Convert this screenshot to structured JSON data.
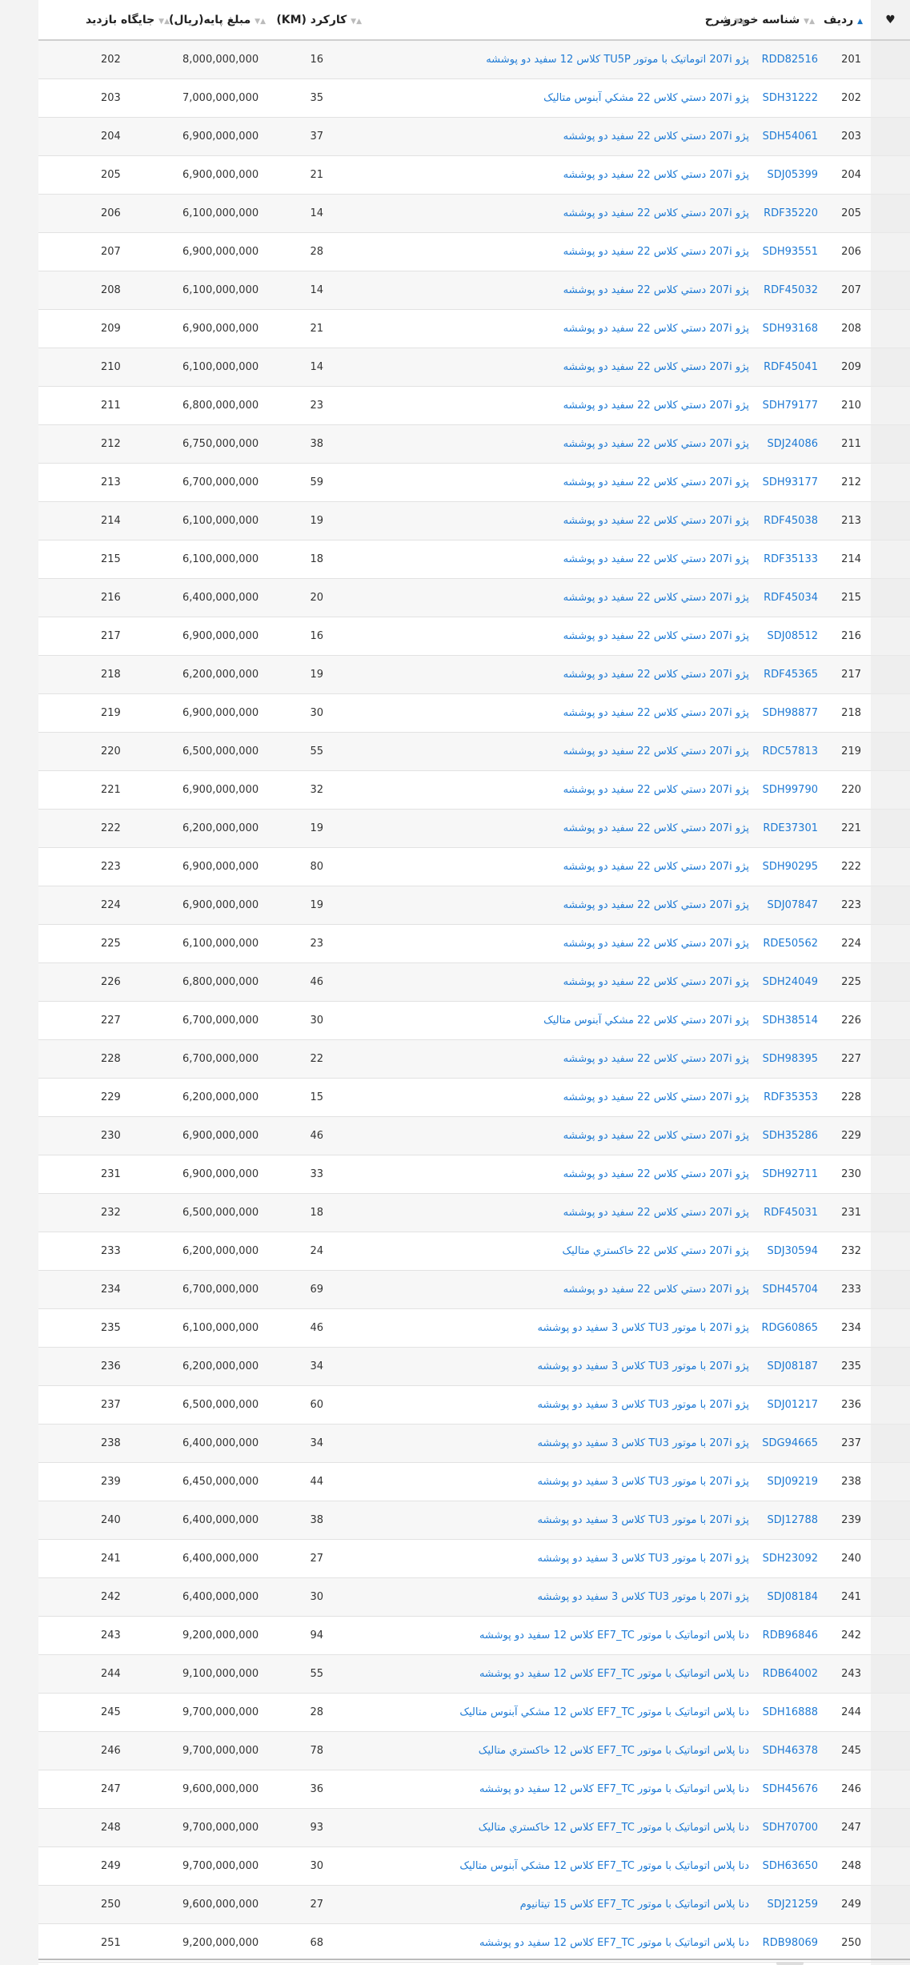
{
  "table": {
    "headers": {
      "favorite_icon": "heart-icon",
      "row": "ردیف",
      "id": "شناسه خودرو",
      "desc": "شرح",
      "km": "کارکرد (KM)",
      "price": "مبلغ پایه(ریال)",
      "visit": "جایگاه بازدید"
    },
    "rows": [
      {
        "row": "201",
        "id": "RDD82516",
        "desc": "پژو 207i اتوماتیک با موتور TU5P کلاس 12 سفید دو پوششه",
        "km": "16",
        "price": "8,000,000,000",
        "visit": "202"
      },
      {
        "row": "202",
        "id": "SDH31222",
        "desc": "پژو 207i دستي کلاس 22 مشکي آبنوس متاليک",
        "km": "35",
        "price": "7,000,000,000",
        "visit": "203"
      },
      {
        "row": "203",
        "id": "SDH54061",
        "desc": "پژو 207i دستي کلاس 22 سفيد دو پوششه",
        "km": "37",
        "price": "6,900,000,000",
        "visit": "204"
      },
      {
        "row": "204",
        "id": "SDJ05399",
        "desc": "پژو 207i دستي کلاس 22 سفيد دو پوششه",
        "km": "21",
        "price": "6,900,000,000",
        "visit": "205"
      },
      {
        "row": "205",
        "id": "RDF35220",
        "desc": "پژو 207i دستي کلاس 22 سفيد دو پوششه",
        "km": "14",
        "price": "6,100,000,000",
        "visit": "206"
      },
      {
        "row": "206",
        "id": "SDH93551",
        "desc": "پژو 207i دستي کلاس 22 سفيد دو پوششه",
        "km": "28",
        "price": "6,900,000,000",
        "visit": "207"
      },
      {
        "row": "207",
        "id": "RDF45032",
        "desc": "پژو 207i دستي کلاس 22 سفيد دو پوششه",
        "km": "14",
        "price": "6,100,000,000",
        "visit": "208"
      },
      {
        "row": "208",
        "id": "SDH93168",
        "desc": "پژو 207i دستي کلاس 22 سفيد دو پوششه",
        "km": "21",
        "price": "6,900,000,000",
        "visit": "209"
      },
      {
        "row": "209",
        "id": "RDF45041",
        "desc": "پژو 207i دستي کلاس 22 سفيد دو پوششه",
        "km": "14",
        "price": "6,100,000,000",
        "visit": "210"
      },
      {
        "row": "210",
        "id": "SDH79177",
        "desc": "پژو 207i دستي کلاس 22 سفيد دو پوششه",
        "km": "23",
        "price": "6,800,000,000",
        "visit": "211"
      },
      {
        "row": "211",
        "id": "SDJ24086",
        "desc": "پژو 207i دستي کلاس 22 سفيد دو پوششه",
        "km": "38",
        "price": "6,750,000,000",
        "visit": "212"
      },
      {
        "row": "212",
        "id": "SDH93177",
        "desc": "پژو 207i دستي کلاس 22 سفيد دو پوششه",
        "km": "59",
        "price": "6,700,000,000",
        "visit": "213"
      },
      {
        "row": "213",
        "id": "RDF45038",
        "desc": "پژو 207i دستي کلاس 22 سفيد دو پوششه",
        "km": "19",
        "price": "6,100,000,000",
        "visit": "214"
      },
      {
        "row": "214",
        "id": "RDF35133",
        "desc": "پژو 207i دستي کلاس 22 سفيد دو پوششه",
        "km": "18",
        "price": "6,100,000,000",
        "visit": "215"
      },
      {
        "row": "215",
        "id": "RDF45034",
        "desc": "پژو 207i دستي کلاس 22 سفيد دو پوششه",
        "km": "20",
        "price": "6,400,000,000",
        "visit": "216"
      },
      {
        "row": "216",
        "id": "SDJ08512",
        "desc": "پژو 207i دستي کلاس 22 سفيد دو پوششه",
        "km": "16",
        "price": "6,900,000,000",
        "visit": "217"
      },
      {
        "row": "217",
        "id": "RDF45365",
        "desc": "پژو 207i دستي کلاس 22 سفيد دو پوششه",
        "km": "19",
        "price": "6,200,000,000",
        "visit": "218"
      },
      {
        "row": "218",
        "id": "SDH98877",
        "desc": "پژو 207i دستي کلاس 22 سفيد دو پوششه",
        "km": "30",
        "price": "6,900,000,000",
        "visit": "219"
      },
      {
        "row": "219",
        "id": "RDC57813",
        "desc": "پژو 207i دستي کلاس 22 سفيد دو پوششه",
        "km": "55",
        "price": "6,500,000,000",
        "visit": "220"
      },
      {
        "row": "220",
        "id": "SDH99790",
        "desc": "پژو 207i دستي کلاس 22 سفيد دو پوششه",
        "km": "32",
        "price": "6,900,000,000",
        "visit": "221"
      },
      {
        "row": "221",
        "id": "RDE37301",
        "desc": "پژو 207i دستي کلاس 22 سفيد دو پوششه",
        "km": "19",
        "price": "6,200,000,000",
        "visit": "222"
      },
      {
        "row": "222",
        "id": "SDH90295",
        "desc": "پژو 207i دستي کلاس 22 سفيد دو پوششه",
        "km": "80",
        "price": "6,900,000,000",
        "visit": "223"
      },
      {
        "row": "223",
        "id": "SDJ07847",
        "desc": "پژو 207i دستي کلاس 22 سفيد دو پوششه",
        "km": "19",
        "price": "6,900,000,000",
        "visit": "224"
      },
      {
        "row": "224",
        "id": "RDE50562",
        "desc": "پژو 207i دستي کلاس 22 سفيد دو پوششه",
        "km": "23",
        "price": "6,100,000,000",
        "visit": "225"
      },
      {
        "row": "225",
        "id": "SDH24049",
        "desc": "پژو 207i دستي کلاس 22 سفيد دو پوششه",
        "km": "46",
        "price": "6,800,000,000",
        "visit": "226"
      },
      {
        "row": "226",
        "id": "SDH38514",
        "desc": "پژو 207i دستي کلاس 22 مشکي آبنوس متاليک",
        "km": "30",
        "price": "6,700,000,000",
        "visit": "227"
      },
      {
        "row": "227",
        "id": "SDH98395",
        "desc": "پژو 207i دستي کلاس 22 سفيد دو پوششه",
        "km": "22",
        "price": "6,700,000,000",
        "visit": "228"
      },
      {
        "row": "228",
        "id": "RDF35353",
        "desc": "پژو 207i دستي کلاس 22 سفيد دو پوششه",
        "km": "15",
        "price": "6,200,000,000",
        "visit": "229"
      },
      {
        "row": "229",
        "id": "SDH35286",
        "desc": "پژو 207i دستي کلاس 22 سفيد دو پوششه",
        "km": "46",
        "price": "6,900,000,000",
        "visit": "230"
      },
      {
        "row": "230",
        "id": "SDH92711",
        "desc": "پژو 207i دستي کلاس 22 سفيد دو پوششه",
        "km": "33",
        "price": "6,900,000,000",
        "visit": "231"
      },
      {
        "row": "231",
        "id": "RDF45031",
        "desc": "پژو 207i دستي کلاس 22 سفيد دو پوششه",
        "km": "18",
        "price": "6,500,000,000",
        "visit": "232"
      },
      {
        "row": "232",
        "id": "SDJ30594",
        "desc": "پژو 207i دستي کلاس 22 خاکستري متاليک",
        "km": "24",
        "price": "6,200,000,000",
        "visit": "233"
      },
      {
        "row": "233",
        "id": "SDH45704",
        "desc": "پژو 207i دستي کلاس 22 سفيد دو پوششه",
        "km": "69",
        "price": "6,700,000,000",
        "visit": "234"
      },
      {
        "row": "234",
        "id": "RDG60865",
        "desc": "پژو 207i با موتور TU3 کلاس 3 سفيد دو پوششه",
        "km": "46",
        "price": "6,100,000,000",
        "visit": "235"
      },
      {
        "row": "235",
        "id": "SDJ08187",
        "desc": "پژو 207i با موتور TU3 کلاس 3 سفيد دو پوششه",
        "km": "34",
        "price": "6,200,000,000",
        "visit": "236"
      },
      {
        "row": "236",
        "id": "SDJ01217",
        "desc": "پژو 207i با موتور TU3 کلاس 3 سفيد دو پوششه",
        "km": "60",
        "price": "6,500,000,000",
        "visit": "237"
      },
      {
        "row": "237",
        "id": "SDG94665",
        "desc": "پژو 207i با موتور TU3 کلاس 3 سفيد دو پوششه",
        "km": "34",
        "price": "6,400,000,000",
        "visit": "238"
      },
      {
        "row": "238",
        "id": "SDJ09219",
        "desc": "پژو 207i با موتور TU3 کلاس 3 سفيد دو پوششه",
        "km": "44",
        "price": "6,450,000,000",
        "visit": "239"
      },
      {
        "row": "239",
        "id": "SDJ12788",
        "desc": "پژو 207i با موتور TU3 کلاس 3 سفيد دو پوششه",
        "km": "38",
        "price": "6,400,000,000",
        "visit": "240"
      },
      {
        "row": "240",
        "id": "SDH23092",
        "desc": "پژو 207i با موتور TU3 کلاس 3 سفيد دو پوششه",
        "km": "27",
        "price": "6,400,000,000",
        "visit": "241"
      },
      {
        "row": "241",
        "id": "SDJ08184",
        "desc": "پژو 207i با موتور TU3 کلاس 3 سفيد دو پوششه",
        "km": "30",
        "price": "6,400,000,000",
        "visit": "242"
      },
      {
        "row": "242",
        "id": "RDB96846",
        "desc": "دنا پلاس اتوماتيک با موتور EF7_TC کلاس 12 سفيد دو پوششه",
        "km": "94",
        "price": "9,200,000,000",
        "visit": "243"
      },
      {
        "row": "243",
        "id": "RDB64002",
        "desc": "دنا پلاس اتوماتيک با موتور EF7_TC کلاس 12 سفيد دو پوششه",
        "km": "55",
        "price": "9,100,000,000",
        "visit": "244"
      },
      {
        "row": "244",
        "id": "SDH16888",
        "desc": "دنا پلاس اتوماتيک با موتور EF7_TC کلاس 12 مشکي آبنوس متاليک",
        "km": "28",
        "price": "9,700,000,000",
        "visit": "245"
      },
      {
        "row": "245",
        "id": "SDH46378",
        "desc": "دنا پلاس اتوماتيک با موتور EF7_TC کلاس 12 خاکستري متاليک",
        "km": "78",
        "price": "9,700,000,000",
        "visit": "246"
      },
      {
        "row": "246",
        "id": "SDH45676",
        "desc": "دنا پلاس اتوماتيک با موتور EF7_TC کلاس 12 سفيد دو پوششه",
        "km": "36",
        "price": "9,600,000,000",
        "visit": "247"
      },
      {
        "row": "247",
        "id": "SDH70700",
        "desc": "دنا پلاس اتوماتيک با موتور EF7_TC کلاس 12 خاکستري متاليک",
        "km": "93",
        "price": "9,700,000,000",
        "visit": "248"
      },
      {
        "row": "248",
        "id": "SDH63650",
        "desc": "دنا پلاس اتوماتيک با موتور EF7_TC کلاس 12 مشکي آبنوس متاليک",
        "km": "30",
        "price": "9,700,000,000",
        "visit": "249"
      },
      {
        "row": "249",
        "id": "SDJ21259",
        "desc": "دنا پلاس اتوماتيک با موتور EF7_TC کلاس 15 تيتانيوم",
        "km": "27",
        "price": "9,600,000,000",
        "visit": "250"
      },
      {
        "row": "250",
        "id": "RDB98069",
        "desc": "دنا پلاس اتوماتيک با موتور EF7_TC کلاس 12 سفيد دو پوششه",
        "km": "68",
        "price": "9,200,000,000",
        "visit": "251"
      }
    ]
  },
  "colors": {
    "link": "#1e7ad4",
    "active_sort": "#1a73c4",
    "stripe": "#f7f7f7"
  }
}
